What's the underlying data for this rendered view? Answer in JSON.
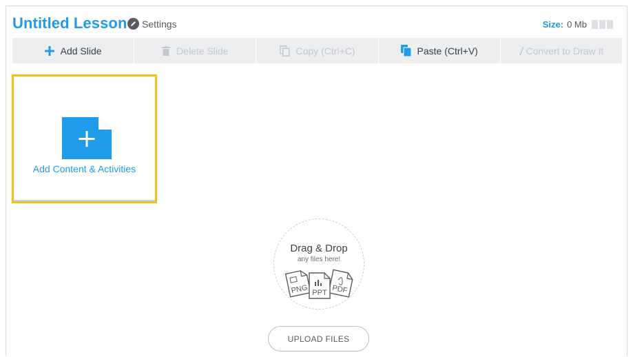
{
  "header": {
    "title": "Untitled Lesson",
    "settings_label": "Settings",
    "size_label": "Size:",
    "size_value": "0 Mb"
  },
  "toolbar": {
    "add_slide": "Add Slide",
    "delete_slide": "Delete Slide",
    "copy": "Copy (Ctrl+C)",
    "paste": "Paste (Ctrl+V)",
    "convert": "Convert to Draw It"
  },
  "slide": {
    "add_label": "Add Content & Activities"
  },
  "drop_zone": {
    "title": "Drag & Drop",
    "subtitle": "any files here!",
    "file_types": [
      "PNG",
      "PPT",
      "PDF"
    ]
  },
  "upload": {
    "label": "UPLOAD FILES"
  },
  "colors": {
    "accent": "#1e9be9",
    "highlight": "#f3c01a",
    "toolbar_bg": "#eceef0",
    "disabled": "#c4c8cc"
  },
  "icons": {
    "settings": "pencil-icon",
    "add_slide": "plus-icon",
    "delete_slide": "trash-icon",
    "copy": "copy-icon",
    "paste": "paste-icon",
    "convert": "slash-pen-icon",
    "add_content": "add-document-icon"
  }
}
